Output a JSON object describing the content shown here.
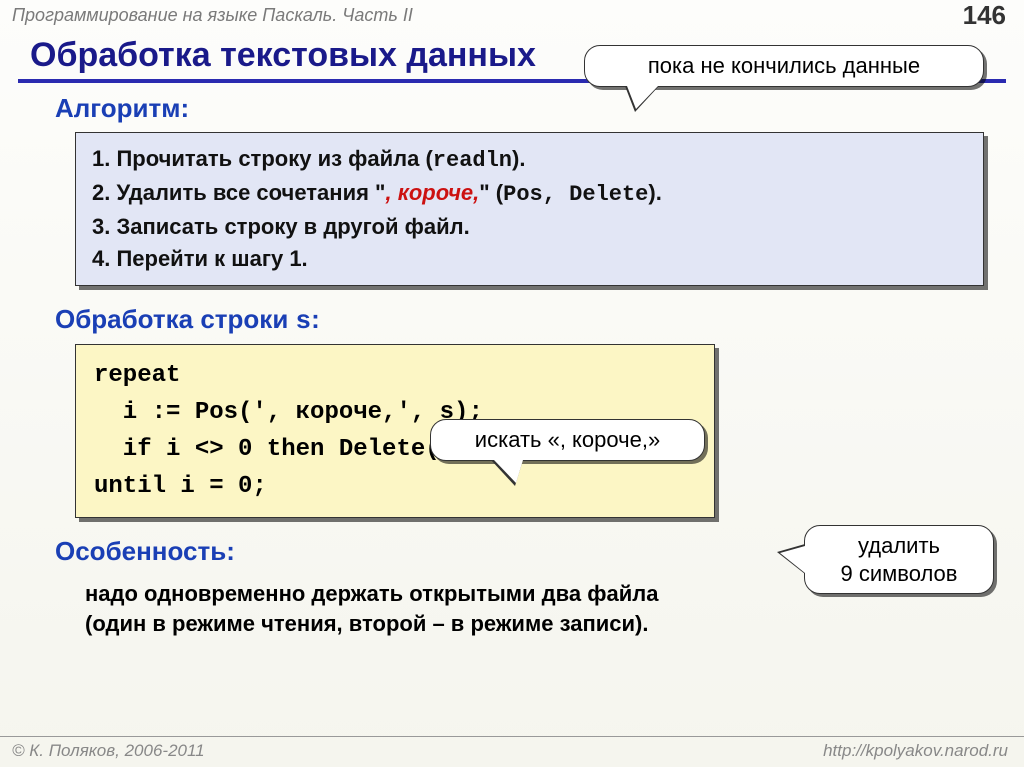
{
  "header": {
    "course": "Программирование на языке Паскаль. Часть II",
    "page": "146"
  },
  "title": "Обработка текстовых данных",
  "algo": {
    "label": "Алгоритм:",
    "line1_a": "1. Прочитать строку из файла (",
    "line1_b": "readln",
    "line1_c": ").",
    "line2_a": "2. Удалить все сочетания \"",
    "line2_b": ", короче,",
    "line2_c": "\" (",
    "line2_d": "Pos",
    "line2_e": ", ",
    "line2_f": "Delete",
    "line2_g": ").",
    "line3": "3. Записать строку в другой файл.",
    "line4": "4. Перейти к шагу 1."
  },
  "callout_top": "пока не кончились данные",
  "proc": {
    "label_a": "Обработка строки ",
    "label_b": "s",
    "label_c": ":",
    "code1": "repeat",
    "code2": "  i := Pos(', короче,', s);",
    "code3": "  if i <> 0 then Delete(s, i, 9);",
    "code4": "until i = 0;"
  },
  "callout_mid": "искать «, короче,»",
  "callout_right_l1": "удалить",
  "callout_right_l2": "9 символов",
  "feature": {
    "label": "Особенность:",
    "text_l1": "надо одновременно держать открытыми два файла",
    "text_l2": "(один в режиме чтения, второй – в режиме записи)."
  },
  "footer": {
    "left": "© К. Поляков, 2006-2011",
    "right": "http://kpolyakov.narod.ru"
  }
}
